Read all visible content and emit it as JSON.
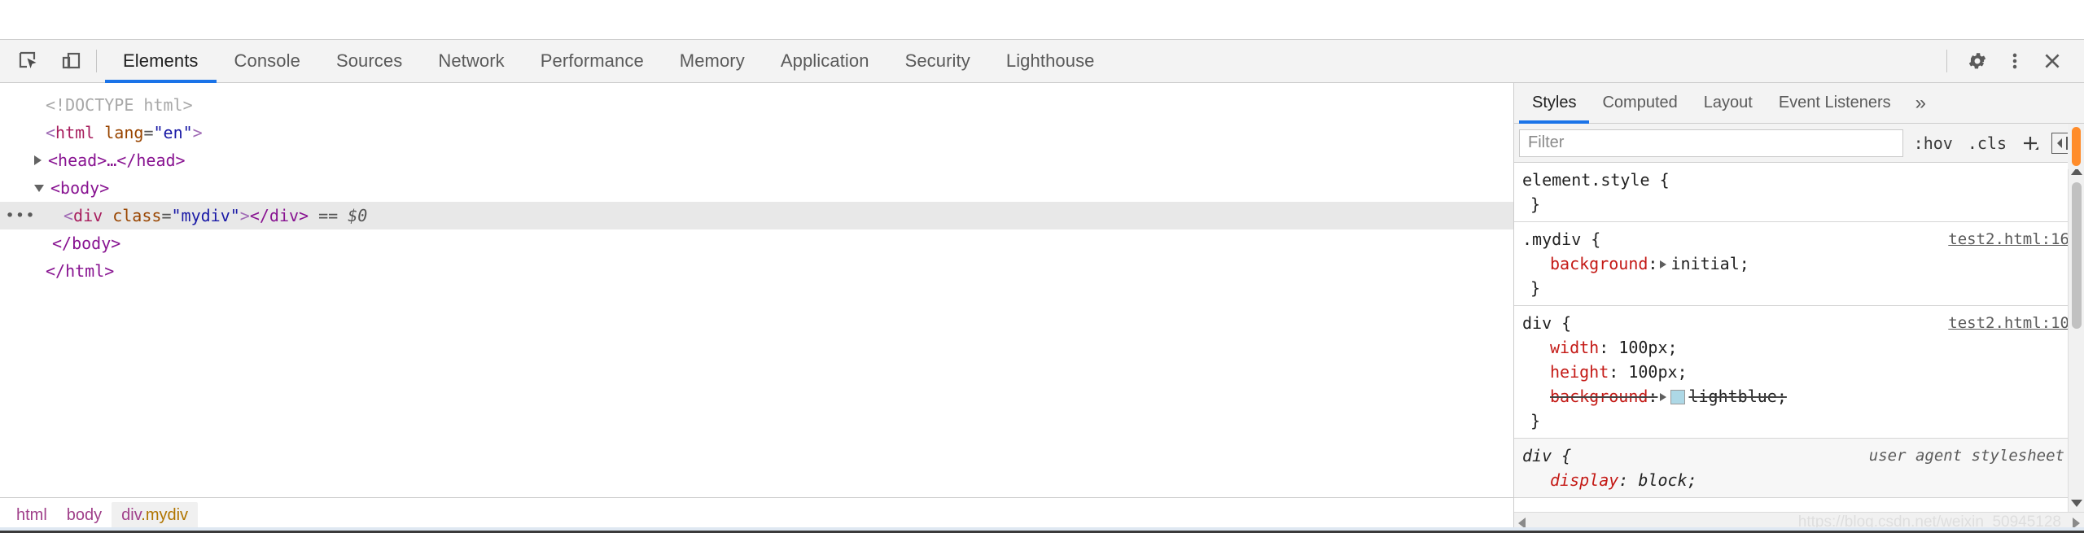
{
  "toolbar": {
    "icons": [
      {
        "name": "inspect-element-icon",
        "title": "Inspect element"
      },
      {
        "name": "device-toolbar-icon",
        "title": "Toggle device toolbar"
      }
    ],
    "tabs": [
      {
        "label": "Elements",
        "active": true
      },
      {
        "label": "Console",
        "active": false
      },
      {
        "label": "Sources",
        "active": false
      },
      {
        "label": "Network",
        "active": false
      },
      {
        "label": "Performance",
        "active": false
      },
      {
        "label": "Memory",
        "active": false
      },
      {
        "label": "Application",
        "active": false
      },
      {
        "label": "Security",
        "active": false
      },
      {
        "label": "Lighthouse",
        "active": false
      }
    ],
    "right_icons": [
      {
        "name": "settings-gear-icon"
      },
      {
        "name": "more-options-icon"
      },
      {
        "name": "close-devtools-icon"
      }
    ],
    "accent_color": "#1a73e8"
  },
  "dom_tree": {
    "rows": [
      {
        "id": "doctype",
        "indent": 1,
        "marker": "none",
        "selected": false,
        "text": "<!DOCTYPE html>"
      },
      {
        "id": "html-open",
        "indent": 1,
        "marker": "none",
        "selected": false,
        "tag_open": "<",
        "tag_name": "html",
        "attr_name": "lang",
        "attr_eq": "=",
        "attr_value": "\"en\"",
        "tag_close": ">"
      },
      {
        "id": "head",
        "indent": 2,
        "marker": "closed",
        "selected": false,
        "text": "<head>…</head>"
      },
      {
        "id": "body-open",
        "indent": 2,
        "marker": "open",
        "selected": false,
        "text": "<body>"
      },
      {
        "id": "mydiv",
        "indent": 3,
        "marker": "dots",
        "selected": true,
        "tag_open": "<",
        "tag_name": "div",
        "attr_name": "class",
        "attr_eq": "=",
        "attr_value": "\"mydiv\"",
        "tag_close": ">",
        "tag_end": "</div>",
        "suffix": " == ",
        "console_ref": "$0"
      },
      {
        "id": "body-close",
        "indent": 2,
        "marker": "none",
        "selected": false,
        "text": "</body>"
      },
      {
        "id": "html-close",
        "indent": 1,
        "marker": "none",
        "selected": false,
        "text": "</html>"
      }
    ]
  },
  "breadcrumb": {
    "items": [
      {
        "text": "html",
        "cls": "",
        "active": false
      },
      {
        "text": "body",
        "cls": "",
        "active": false
      },
      {
        "text": "div",
        "cls": ".mydiv",
        "active": true
      }
    ]
  },
  "styles_panel": {
    "tabs": [
      {
        "label": "Styles",
        "active": true
      },
      {
        "label": "Computed",
        "active": false
      },
      {
        "label": "Layout",
        "active": false
      },
      {
        "label": "Event Listeners",
        "active": false
      }
    ],
    "more_label": "»",
    "filter": {
      "value": "",
      "placeholder": "Filter"
    },
    "buttons": [
      {
        "label": ":hov",
        "name": "toggle-hover-state-button"
      },
      {
        "label": ".cls",
        "name": "toggle-class-button"
      },
      {
        "label": "+",
        "name": "new-style-rule-button"
      }
    ],
    "sidebar_toggle_name": "toggle-computed-sidebar-icon",
    "rules": [
      {
        "id": "element-style",
        "selector": "element.style {",
        "close": "}",
        "origin": "",
        "origin_is_link": false,
        "ua": false,
        "declarations": []
      },
      {
        "id": "mydiv-rule",
        "selector": ".mydiv {",
        "close": "}",
        "origin": "test2.html:16",
        "origin_is_link": true,
        "ua": false,
        "declarations": [
          {
            "prop": "background",
            "colon": ":",
            "has_expand_arrow": true,
            "value": "initial;",
            "struck": false,
            "swatch": ""
          }
        ]
      },
      {
        "id": "div-rule",
        "selector": "div {",
        "close": "}",
        "origin": "test2.html:10",
        "origin_is_link": true,
        "ua": false,
        "declarations": [
          {
            "prop": "width",
            "colon": ":",
            "has_expand_arrow": false,
            "value": "100px;",
            "struck": false,
            "swatch": ""
          },
          {
            "prop": "height",
            "colon": ":",
            "has_expand_arrow": false,
            "value": "100px;",
            "struck": false,
            "swatch": ""
          },
          {
            "prop": "background",
            "colon": ":",
            "has_expand_arrow": true,
            "value": "lightblue;",
            "struck": true,
            "swatch": "#add8e6"
          }
        ]
      },
      {
        "id": "div-ua-rule",
        "selector": "div {",
        "close": "",
        "origin": "user agent stylesheet",
        "origin_is_link": false,
        "ua": true,
        "declarations": [
          {
            "prop": "display",
            "colon": ":",
            "has_expand_arrow": false,
            "value": "block;",
            "struck": false,
            "swatch": ""
          }
        ]
      }
    ],
    "watermark": "https://blog.csdn.net/weixin_50945128"
  }
}
